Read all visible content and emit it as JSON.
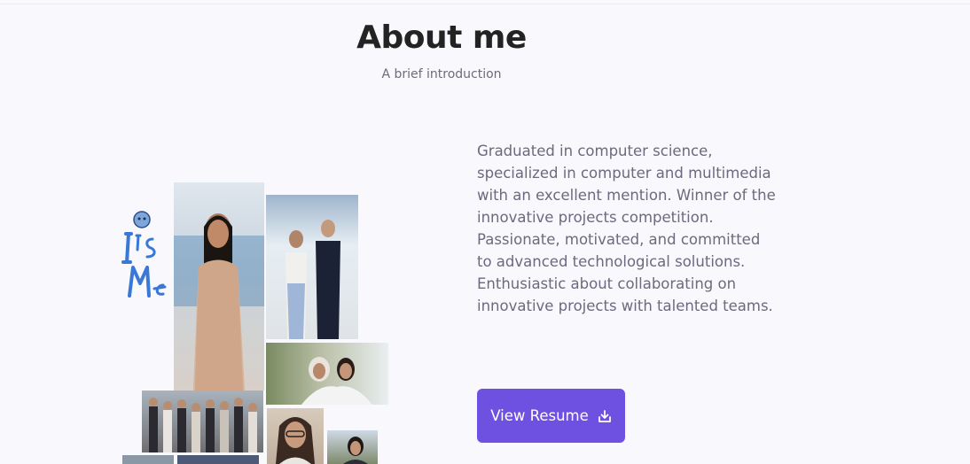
{
  "header": {
    "title": "About me",
    "subtitle": "A brief introduction"
  },
  "bio": {
    "text": "Graduated in computer science, specialized in computer and multimedia with an excellent mention. Winner of the innovative projects competition. Passionate, motivated, and committed to advanced technological solutions. Enthusiastic about collaborating on innovative projects with talented teams."
  },
  "resume_button": {
    "label": "View Resume",
    "icon": "download-icon"
  },
  "collage": {
    "sticker_text": "ITs Me"
  },
  "colors": {
    "accent": "#6e51e0",
    "background": "#f9f8fc",
    "title": "#232323",
    "body_text": "#6b6a7e"
  }
}
